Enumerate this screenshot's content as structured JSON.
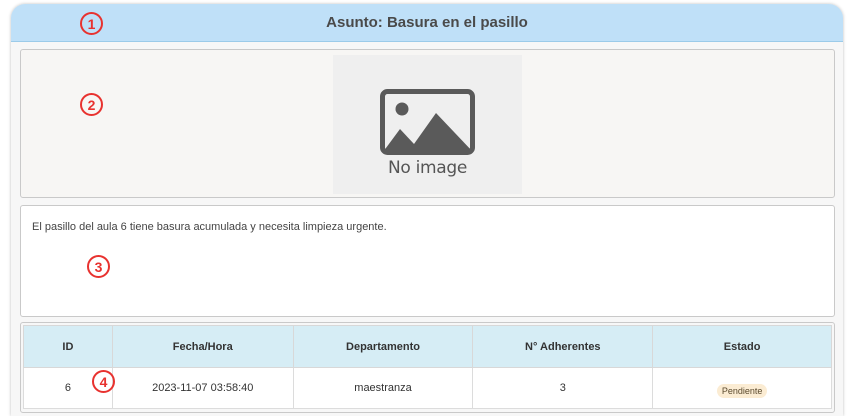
{
  "header": {
    "title": "Asunto: Basura en el pasillo"
  },
  "image": {
    "placeholder_text": "No image"
  },
  "description": "El pasillo del aula 6 tiene basura acumulada y necesita limpieza urgente.",
  "table": {
    "columns": [
      "ID",
      "Fecha/Hora",
      "Departamento",
      "N° Adherentes",
      "Estado"
    ],
    "rows": [
      {
        "id": "6",
        "fecha_hora": "2023-11-07 03:58:40",
        "departamento": "maestranza",
        "adherentes": "3",
        "estado": "Pendiente"
      }
    ]
  },
  "markers": [
    "1",
    "2",
    "3",
    "4"
  ],
  "colors": {
    "header_bg": "#bfe0f8",
    "table_header_bg": "#d6edf5",
    "marker": "#e8322f",
    "badge_bg": "#fbecd3"
  }
}
